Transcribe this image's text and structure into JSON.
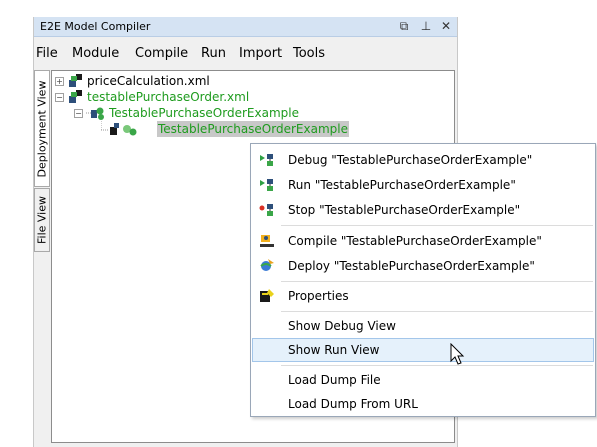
{
  "window": {
    "title": "E2E Model Compiler",
    "buttons": {
      "restore": "⧉",
      "pin": "⊥",
      "close": "✕"
    }
  },
  "menu": [
    "File",
    "Module",
    "Compile",
    "Run",
    "Import",
    "Tools"
  ],
  "side_tabs": [
    "Deployment View",
    "File View"
  ],
  "tree": {
    "node1": "priceCalculation.xml",
    "node2": "testablePurchaseOrder.xml",
    "node3": "TestablePurchaseOrderExample",
    "node4": "TestablePurchaseOrderExample"
  },
  "context_menu": {
    "debug": "Debug \"TestablePurchaseOrderExample\"",
    "run": "Run \"TestablePurchaseOrderExample\"",
    "stop": "Stop \"TestablePurchaseOrderExample\"",
    "compile": "Compile \"TestablePurchaseOrderExample\"",
    "deploy": "Deploy \"TestablePurchaseOrderExample\"",
    "properties": "Properties",
    "show_debug_view": "Show Debug View",
    "show_run_view": "Show Run View",
    "load_dump_file": "Load Dump File",
    "load_dump_from_url": "Load Dump From URL"
  },
  "colors": {
    "accent_green": "#1e9b1e",
    "titlebar": "#d5e3f3",
    "hover": "#e5f1fb",
    "hover_border": "#a3c6ea"
  }
}
